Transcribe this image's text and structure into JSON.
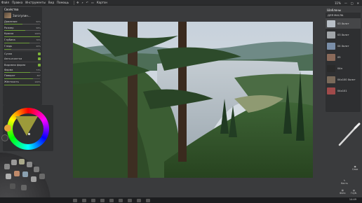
{
  "menu": {
    "items": [
      "Файл",
      "Правка",
      "Инструменты",
      "Вид",
      "Помощь"
    ],
    "layer_label": "Картон"
  },
  "status": {
    "zoom": "11%"
  },
  "properties": {
    "title": "Свойства",
    "tool_name": "Загогулин...",
    "rows": [
      {
        "label": "Давление",
        "value": "50%",
        "fill": 0.5,
        "kind": "slider"
      },
      {
        "label": "Размер",
        "value": "58%",
        "fill": 0.58,
        "kind": "slider"
      },
      {
        "label": "Краска",
        "value": "100%",
        "fill": 1.0,
        "kind": "slider"
      },
      {
        "label": "Глубина",
        "value": "70%",
        "fill": 0.7,
        "kind": "slider"
      },
      {
        "label": "Гладь",
        "value": "20%",
        "fill": 0.2,
        "kind": "slider"
      },
      {
        "label": "Сухая",
        "kind": "check"
      },
      {
        "label": "Авто-очистка",
        "kind": "check"
      },
      {
        "label": "Видимая форма",
        "kind": "check"
      },
      {
        "label": "Форма",
        "value": "73%",
        "fill": 0.73,
        "kind": "slider"
      },
      {
        "label": "Поворот",
        "value": "80°",
        "fill": 0.8,
        "kind": "slider"
      },
      {
        "label": "Жёсткость",
        "value": "100%",
        "fill": 1.0,
        "kind": "slider"
      }
    ]
  },
  "right_panel": {
    "title": "Шаблоны",
    "subtitle": "ДЛЯ МАСЛА",
    "items": [
      {
        "label": "03 Холст",
        "color": "#b9c0c8",
        "selected": true
      },
      {
        "label": "03 Холст",
        "color": "#a2a6aa"
      },
      {
        "label": "04 Холст",
        "color": "#7a8ea8"
      },
      {
        "label": "05",
        "color": "#8a6a5a"
      },
      {
        "label": "04н",
        "color": "#2a2a2a"
      },
      {
        "label": "04x100 Холст",
        "color": "#7a6a5a"
      },
      {
        "label": "04x101",
        "color": "#a04a4a"
      }
    ]
  },
  "right_tools": {
    "clear_label": "Слои",
    "brush_label": "Кисть",
    "fill_label": "Фото",
    "ref_label": "Глуб."
  },
  "taskbar": {
    "time": "14:49"
  },
  "colors": {
    "accent": "#7db33a"
  }
}
